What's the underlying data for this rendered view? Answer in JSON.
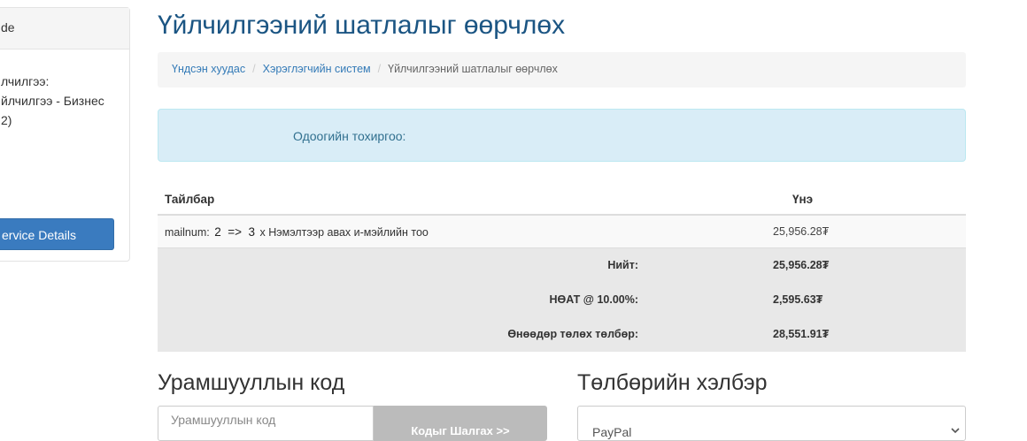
{
  "sidebar": {
    "header": "de",
    "lines": [
      "лчилгээ:",
      "йлчилгээ - Бизнес",
      "2)"
    ],
    "button_label": "ervice Details"
  },
  "page_title": "Үйлчилгээний шатлалыг өөрчлөх",
  "breadcrumb": {
    "items": [
      "Үндсэн хуудас",
      "Хэрэглэгчийн систем"
    ],
    "active": "Үйлчилгээний шатлалыг өөрчлөх"
  },
  "alert": {
    "text": "Одоогийн тохиргоо:"
  },
  "table": {
    "headers": {
      "description": "Тайлбар",
      "price": "Үнэ"
    },
    "row": {
      "prefix": "mailnum:",
      "from": "2",
      "arrow": "=>",
      "to": "3",
      "description": "x Нэмэлтээр авах и-мэйлийн тоо",
      "price": "25,956.28₮"
    },
    "totals": [
      {
        "label": "Нийт:",
        "value": "25,956.28₮"
      },
      {
        "label": "НӨАТ @ 10.00%:",
        "value": "2,595.63₮"
      },
      {
        "label": "Өнөөдөр төлөх төлбөр:",
        "value": "28,551.91₮"
      }
    ]
  },
  "promo": {
    "title": "Урамшууллын код",
    "placeholder": "Урамшууллын код",
    "button_label": "Кодыг Шалгах >>"
  },
  "payment": {
    "title": "Төлбөрийн хэлбэр",
    "selected": "PayPal"
  },
  "colors": {
    "title": "#1b5583",
    "link": "#337ab7",
    "alert_bg": "#d9edf7",
    "alert_text": "#31708f",
    "button_primary": "#3a7bbf",
    "button_disabled": "#bbbbbb"
  },
  "icons": {
    "select_caret": "chevron-down-icon"
  }
}
